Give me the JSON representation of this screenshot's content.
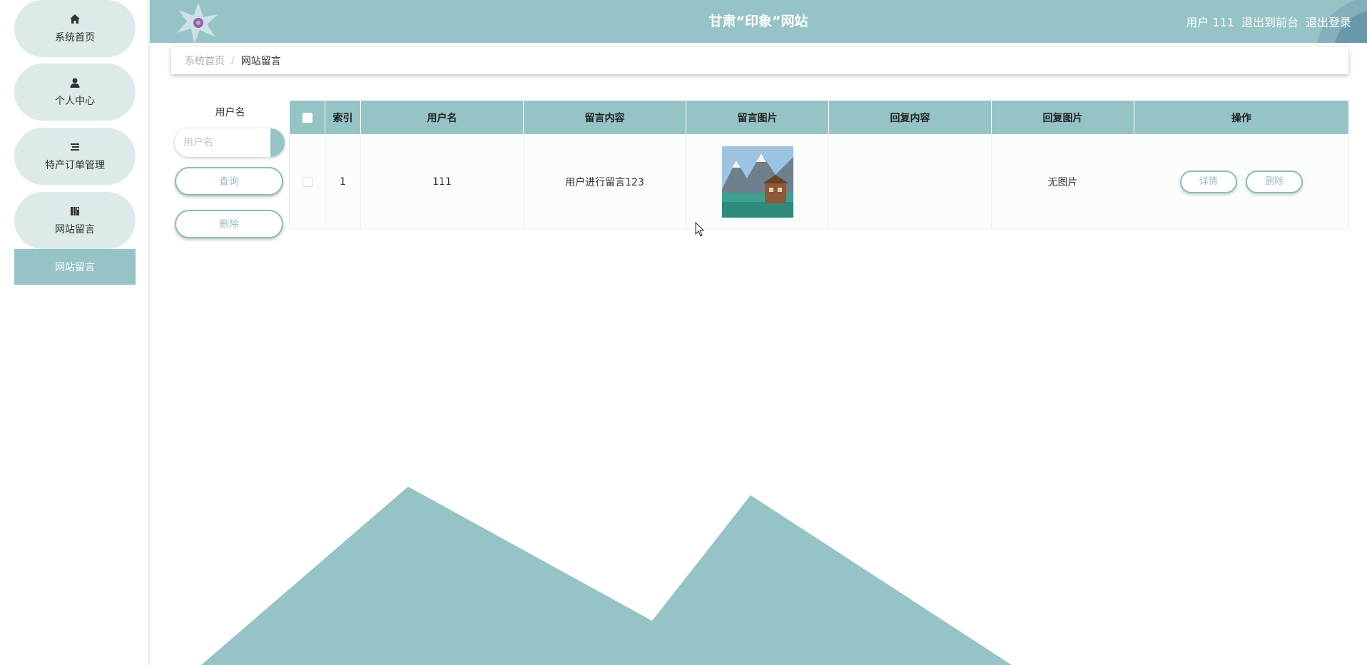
{
  "sidebar": {
    "items": [
      {
        "label": "系统首页",
        "icon": "home-icon"
      },
      {
        "label": "个人中心",
        "icon": "user-icon"
      },
      {
        "label": "特产订单管理",
        "icon": "list-icon"
      },
      {
        "label": "网站留言",
        "icon": "book-icon"
      }
    ],
    "active_sub": "网站留言"
  },
  "header": {
    "title": "甘肃“印象”网站",
    "user": "用户 111",
    "to_front": "退出到前台",
    "logout": "退出登录"
  },
  "breadcrumb": {
    "home": "系统首页",
    "separator": "/",
    "current": "网站留言"
  },
  "search": {
    "label": "用户名",
    "placeholder": "用户名",
    "query_button": "查询",
    "delete_button": "删除"
  },
  "table": {
    "columns": [
      "索引",
      "用户名",
      "留言内容",
      "留言图片",
      "回复内容",
      "回复图片",
      "操作"
    ],
    "rows": [
      {
        "index": "1",
        "username": "111",
        "content": "用户进行留言123",
        "reply": "",
        "reply_image": "无图片",
        "detail_button": "详情",
        "delete_button": "删除"
      }
    ]
  },
  "colors": {
    "accent": "#96c3c6",
    "menu_bg": "#dceaea",
    "button_text": "#9cbfc2"
  }
}
